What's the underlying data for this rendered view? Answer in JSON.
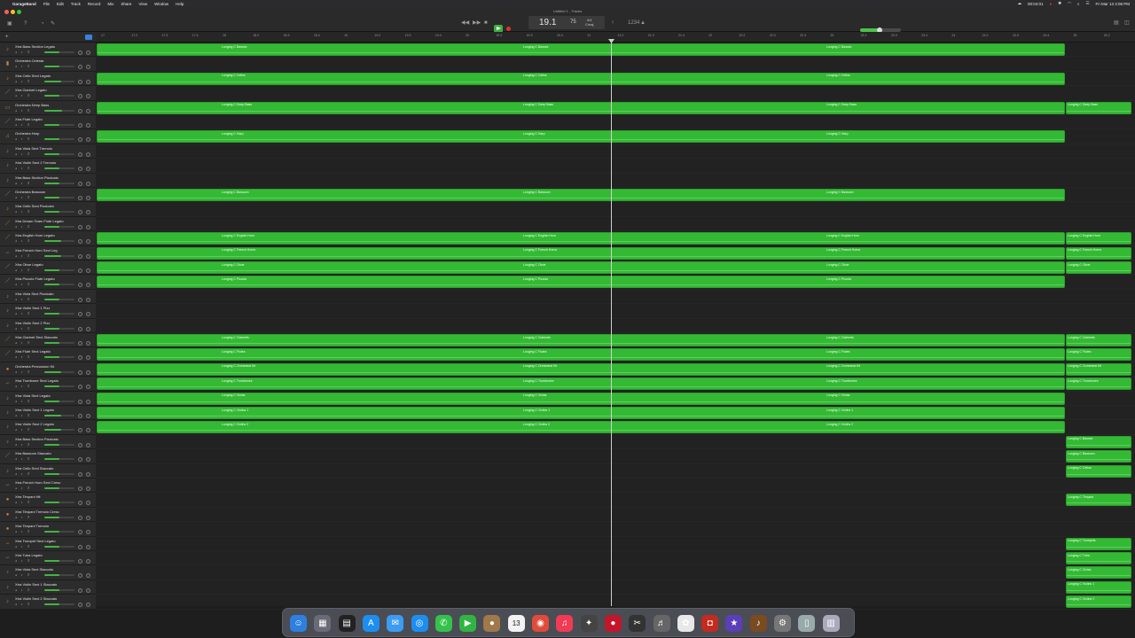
{
  "menubar": {
    "app": "GarageBand",
    "items": [
      "File",
      "Edit",
      "Track",
      "Record",
      "Mix",
      "Share",
      "View",
      "Window",
      "Help"
    ],
    "status": {
      "timer": "00:04:01",
      "datetime": "Fri Mar 13  2:08 PM"
    }
  },
  "toolbar": {
    "window_title": "Untitled 1 - Tracks",
    "lcd": {
      "position": "19.1",
      "tempo": "75",
      "signature": "4/4",
      "key": "Cmaj"
    },
    "master_volume": 0.48
  },
  "ruler": {
    "ticks": [
      "17",
      "17.2",
      "17.3",
      "17.4",
      "18",
      "18.2",
      "18.3",
      "18.4",
      "19",
      "19.2",
      "19.3",
      "19.4",
      "20",
      "20.2",
      "20.3",
      "20.4",
      "21",
      "21.2",
      "21.3",
      "21.4",
      "22",
      "22.2",
      "22.3",
      "22.4",
      "23",
      "23.2",
      "23.3",
      "23.4",
      "24",
      "24.2",
      "24.3",
      "24.4",
      "25",
      "25.2"
    ]
  },
  "tracks": [
    {
      "name": "Xtra Bass Section Legato",
      "icon": "cello-icon",
      "volume": 0.5
    },
    {
      "name": "Orchestra Celesta",
      "icon": "celesta-icon",
      "volume": 0.5
    },
    {
      "name": "Xtra Cello Sect Legato",
      "icon": "cello-icon",
      "volume": 0.55
    },
    {
      "name": "Xtra Clarinet Legato",
      "icon": "wind-icon",
      "volume": 0.5
    },
    {
      "name": "Orchestra Deep Bass",
      "icon": "bass-icon",
      "volume": 0.6
    },
    {
      "name": "Xtra Flute Legato",
      "icon": "wind-icon",
      "volume": 0.5
    },
    {
      "name": "Orchestra Harp",
      "icon": "harp-icon",
      "volume": 0.5
    },
    {
      "name": "Xtra Viola Sect Tremolo",
      "icon": "violin-icon",
      "volume": 0.5
    },
    {
      "name": "Xtra Violin Sect 2 Tremolo",
      "icon": "violin-icon",
      "volume": 0.5
    },
    {
      "name": "Xtra Bass Section Pizzicato",
      "icon": "cello-icon",
      "volume": 0.5
    },
    {
      "name": "Orchestra Bassoon",
      "icon": "wind-icon",
      "volume": 0.5
    },
    {
      "name": "Xtra Cello Sect Pizzicato",
      "icon": "cello-icon",
      "volume": 0.5
    },
    {
      "name": "Xtra Dream Team Flute Legato",
      "icon": "wind-icon",
      "volume": 0.5
    },
    {
      "name": "Xtra English Horn Legato",
      "icon": "wind-icon",
      "volume": 0.55
    },
    {
      "name": "Xtra French Horn Sect Leg",
      "icon": "horn-icon",
      "volume": 0.55
    },
    {
      "name": "Xtra Oboe Legato",
      "icon": "wind-icon",
      "volume": 0.5
    },
    {
      "name": "Xtra Piccolo Flute Legato",
      "icon": "wind-icon",
      "volume": 0.5
    },
    {
      "name": "Xtra Viola Sect Pizzicato",
      "icon": "violin-icon",
      "volume": 0.5
    },
    {
      "name": "Xtra Violin Sect 1 Pizz",
      "icon": "violin-icon",
      "volume": 0.5
    },
    {
      "name": "Xtra Violin Sect 2 Pizz",
      "icon": "violin-icon",
      "volume": 0.5
    },
    {
      "name": "Xtra Clarinet Sect Staccato",
      "icon": "wind-icon",
      "volume": 0.5
    },
    {
      "name": "Xtra Flute Sect Legato",
      "icon": "wind-icon",
      "volume": 0.5
    },
    {
      "name": "Orchestra Percussion Kit",
      "icon": "percussion-icon",
      "volume": 0.55
    },
    {
      "name": "Xtra Trombone Sect Legato",
      "icon": "horn-icon",
      "volume": 0.5
    },
    {
      "name": "Xtra Viola Sect Legato",
      "icon": "violin-icon",
      "volume": 0.5
    },
    {
      "name": "Xtra Violin Sect 1 Legato",
      "icon": "violin-icon",
      "volume": 0.55
    },
    {
      "name": "Xtra Violin Sect 2 Legato",
      "icon": "violin-icon",
      "volume": 0.55
    },
    {
      "name": "Xtra Bass Section Pizzicato",
      "icon": "cello-icon",
      "volume": 0.5
    },
    {
      "name": "Xtra Bassoon Staccato",
      "icon": "wind-icon",
      "volume": 0.5
    },
    {
      "name": "Xtra Cello Sect Staccato",
      "icon": "cello-icon",
      "volume": 0.5
    },
    {
      "name": "Xtra French Horn Sect Cresc",
      "icon": "horn-icon",
      "volume": 0.5
    },
    {
      "name": "Xtra Timpani Hit",
      "icon": "percussion-icon",
      "volume": 0.5
    },
    {
      "name": "Xtra Timpani Tremolo Cresc",
      "icon": "percussion-icon",
      "volume": 0.5
    },
    {
      "name": "Xtra Timpani Tremolo",
      "icon": "percussion-icon",
      "volume": 0.5
    },
    {
      "name": "Xtra Trumpet Sect Legato",
      "icon": "horn-icon",
      "volume": 0.5
    },
    {
      "name": "Xtra Tuba Legato",
      "icon": "horn-icon",
      "volume": 0.5
    },
    {
      "name": "Xtra Viola Sect Staccato",
      "icon": "violin-icon",
      "volume": 0.5
    },
    {
      "name": "Xtra Violin Sect 1 Staccato",
      "icon": "violin-icon",
      "volume": 0.5
    },
    {
      "name": "Xtra Violin Sect 2 Staccato",
      "icon": "violin-icon",
      "volume": 0.5
    }
  ],
  "regions": [
    {
      "track": 0,
      "main": "Longing C Basses",
      "tail": ""
    },
    {
      "track": 2,
      "main": "Longing C Cellos",
      "tail": ""
    },
    {
      "track": 4,
      "main": "Longing C Deep Bass",
      "tail": "Longing C Deep Bass"
    },
    {
      "track": 6,
      "main": "Longing C Harp",
      "tail": ""
    },
    {
      "track": 10,
      "main": "Longing C Bassoon",
      "tail": ""
    },
    {
      "track": 13,
      "main": "Longing C English Horn",
      "tail": "Longing C English Horn"
    },
    {
      "track": 14,
      "main": "Longing C French Horns",
      "tail": "Longing C French Horns"
    },
    {
      "track": 15,
      "main": "Longing C Oboe",
      "tail": "Longing C Oboe"
    },
    {
      "track": 16,
      "main": "Longing C Piccolo",
      "tail": ""
    },
    {
      "track": 20,
      "main": "Longing C Clarinets",
      "tail": "Longing C Clarinets"
    },
    {
      "track": 21,
      "main": "Longing C Flutes",
      "tail": "Longing C Flutes"
    },
    {
      "track": 22,
      "main": "Longing C Orchestral Kit",
      "tail": "Longing C Orchestral Kit"
    },
    {
      "track": 23,
      "main": "Longing C Trombones",
      "tail": "Longing C Trombones"
    },
    {
      "track": 24,
      "main": "Longing C Violas",
      "tail": ""
    },
    {
      "track": 25,
      "main": "Longing C Violins 1",
      "tail": ""
    },
    {
      "track": 26,
      "main": "Longing C Violins 2",
      "tail": ""
    },
    {
      "track": 27,
      "main": "",
      "tail": "Longing C Basses"
    },
    {
      "track": 28,
      "main": "",
      "tail": "Longing C Bassoon"
    },
    {
      "track": 29,
      "main": "",
      "tail": "Longing C Cellos"
    },
    {
      "track": 31,
      "main": "",
      "tail": "Longing C Timpani"
    },
    {
      "track": 34,
      "main": "",
      "tail": "Longing C Trumpets"
    },
    {
      "track": 35,
      "main": "",
      "tail": "Longing C Tuba"
    },
    {
      "track": 36,
      "main": "",
      "tail": "Longing C Violas"
    },
    {
      "track": 37,
      "main": "",
      "tail": "Longing C Violins 1"
    },
    {
      "track": 38,
      "main": "",
      "tail": "Longing C Violins 2"
    }
  ],
  "playhead_bar": "19.1",
  "dock": [
    {
      "name": "finder-icon",
      "glyph": "☺",
      "color": "#2d7fe0"
    },
    {
      "name": "launchpad-icon",
      "glyph": "▦",
      "color": "#6a6a78"
    },
    {
      "name": "mission-control-icon",
      "glyph": "▤",
      "color": "#222"
    },
    {
      "name": "app-store-icon",
      "glyph": "A",
      "color": "#1d8ef0"
    },
    {
      "name": "mail-icon",
      "glyph": "✉",
      "color": "#3c9cf3"
    },
    {
      "name": "safari-icon",
      "glyph": "◎",
      "color": "#1d8ef0"
    },
    {
      "name": "messages-icon",
      "glyph": "✆",
      "color": "#35c24a"
    },
    {
      "name": "facetime-icon",
      "glyph": "▶",
      "color": "#30b545"
    },
    {
      "name": "contacts-icon",
      "glyph": "●",
      "color": "#a0784a"
    },
    {
      "name": "calendar-icon",
      "glyph": "13",
      "color": "#f2f2f2"
    },
    {
      "name": "chrome-icon",
      "glyph": "◉",
      "color": "#e04b3a"
    },
    {
      "name": "music-icon",
      "glyph": "♫",
      "color": "#f23a53"
    },
    {
      "name": "logic-icon",
      "glyph": "✦",
      "color": "#444"
    },
    {
      "name": "screen-recorder-icon",
      "glyph": "●",
      "color": "#c4162a"
    },
    {
      "name": "final-cut-icon",
      "glyph": "✂",
      "color": "#333"
    },
    {
      "name": "garageband-icon",
      "glyph": "♬",
      "color": "#666"
    },
    {
      "name": "photos-icon",
      "glyph": "✿",
      "color": "#e8e8e8"
    },
    {
      "name": "photo-booth-icon",
      "glyph": "◘",
      "color": "#c42a1f"
    },
    {
      "name": "imovie-icon",
      "glyph": "★",
      "color": "#5a3fb8"
    },
    {
      "name": "guitar-icon",
      "glyph": "♪",
      "color": "#7a4a20"
    },
    {
      "name": "system-settings-icon",
      "glyph": "⚙",
      "color": "#777"
    },
    {
      "name": "file-icon",
      "glyph": "▯",
      "color": "#9aa"
    },
    {
      "name": "trash-icon",
      "glyph": "▥",
      "color": "#aab"
    }
  ]
}
